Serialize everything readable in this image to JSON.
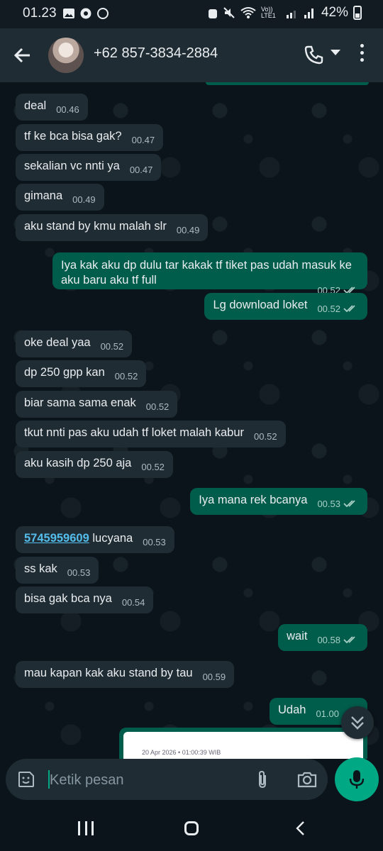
{
  "status_bar": {
    "time": "01.23",
    "volte_label": "Vo)) LTE1",
    "battery": "42%"
  },
  "header": {
    "contact": "+62 857-3834-2884"
  },
  "messages": [
    {
      "dir": "in",
      "text": "deal",
      "time": "00.46"
    },
    {
      "dir": "in",
      "text": "tf ke bca bisa gak?",
      "time": "00.47"
    },
    {
      "dir": "in",
      "text": "sekalian vc nnti ya",
      "time": "00.47"
    },
    {
      "dir": "in",
      "text": "gimana",
      "time": "00.49"
    },
    {
      "dir": "in",
      "text": "aku stand by kmu malah slr",
      "time": "00.49"
    },
    {
      "dir": "out",
      "text": "Iya kak aku dp dulu tar kakak tf tiket pas udah masuk ke aku baru aku tf full",
      "time": "00.52"
    },
    {
      "dir": "out",
      "text": "Lg download loket",
      "time": "00.52"
    },
    {
      "dir": "in",
      "text": "oke deal yaa",
      "time": "00.52"
    },
    {
      "dir": "in",
      "text": "dp 250 gpp kan",
      "time": "00.52"
    },
    {
      "dir": "in",
      "text": "biar sama sama enak",
      "time": "00.52"
    },
    {
      "dir": "in",
      "text": "tkut nnti pas aku udah tf loket malah kabur",
      "time": "00.52"
    },
    {
      "dir": "in",
      "text": "aku kasih dp 250 aja",
      "time": "00.52"
    },
    {
      "dir": "out",
      "text": "Iya mana rek bcanya",
      "time": "00.53"
    },
    {
      "dir": "in",
      "link": "5745959609",
      "text": " lucyana",
      "time": "00.53"
    },
    {
      "dir": "in",
      "text": "ss kak",
      "time": "00.53"
    },
    {
      "dir": "in",
      "text": "bisa gak bca nya",
      "time": "00.54"
    },
    {
      "dir": "out",
      "text": "wait",
      "time": "00.58"
    },
    {
      "dir": "in",
      "text": "mau kapan kak aku stand by tau",
      "time": "00.59"
    },
    {
      "dir": "out",
      "text": "Udah",
      "time": "01.00"
    }
  ],
  "image_preview": {
    "timestamp": "20 Apr 2026 • 01:00:39 WIB"
  },
  "composer": {
    "placeholder": "Ketik pesan"
  }
}
